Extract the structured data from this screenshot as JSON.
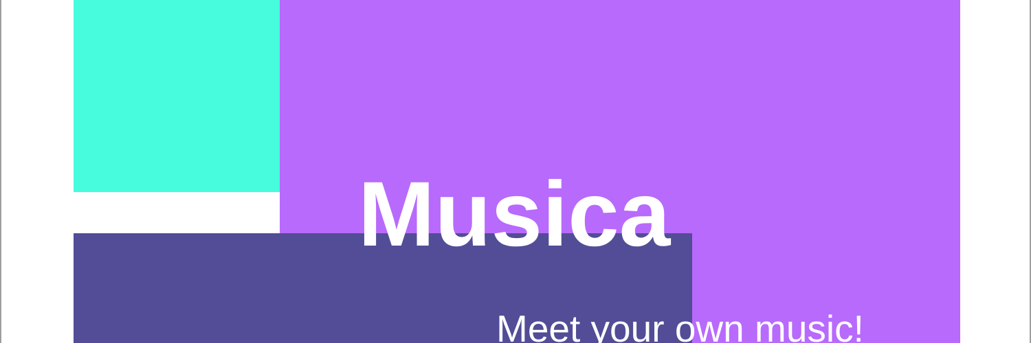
{
  "banner": {
    "title": "Musica",
    "tagline": "Meet your own music!"
  },
  "colors": {
    "background": "#ffffff",
    "border": "#9e9e9e",
    "teal_block": "#47fcdd",
    "purple_block": "#b86afc",
    "indigo_block": "#524d96",
    "text": "#ffffff"
  }
}
